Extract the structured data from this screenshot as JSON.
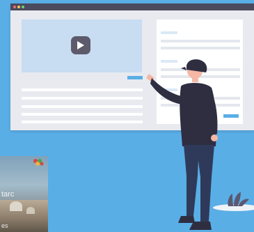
{
  "window": {
    "titlebar_color": "#4b4a5e",
    "dots": [
      "#ef6b6b",
      "#f3c74f",
      "#6cd17a"
    ]
  },
  "video": {
    "icon": "play-icon",
    "accent_color": "#5aaee6"
  },
  "thumbnail": {
    "caption_partial": "tarc",
    "caption_partial_2": "es",
    "badge_icon": "flower-icon"
  },
  "colors": {
    "background": "#5aaee6",
    "panel": "#ffffff",
    "video_placeholder": "#c8dcf2"
  }
}
